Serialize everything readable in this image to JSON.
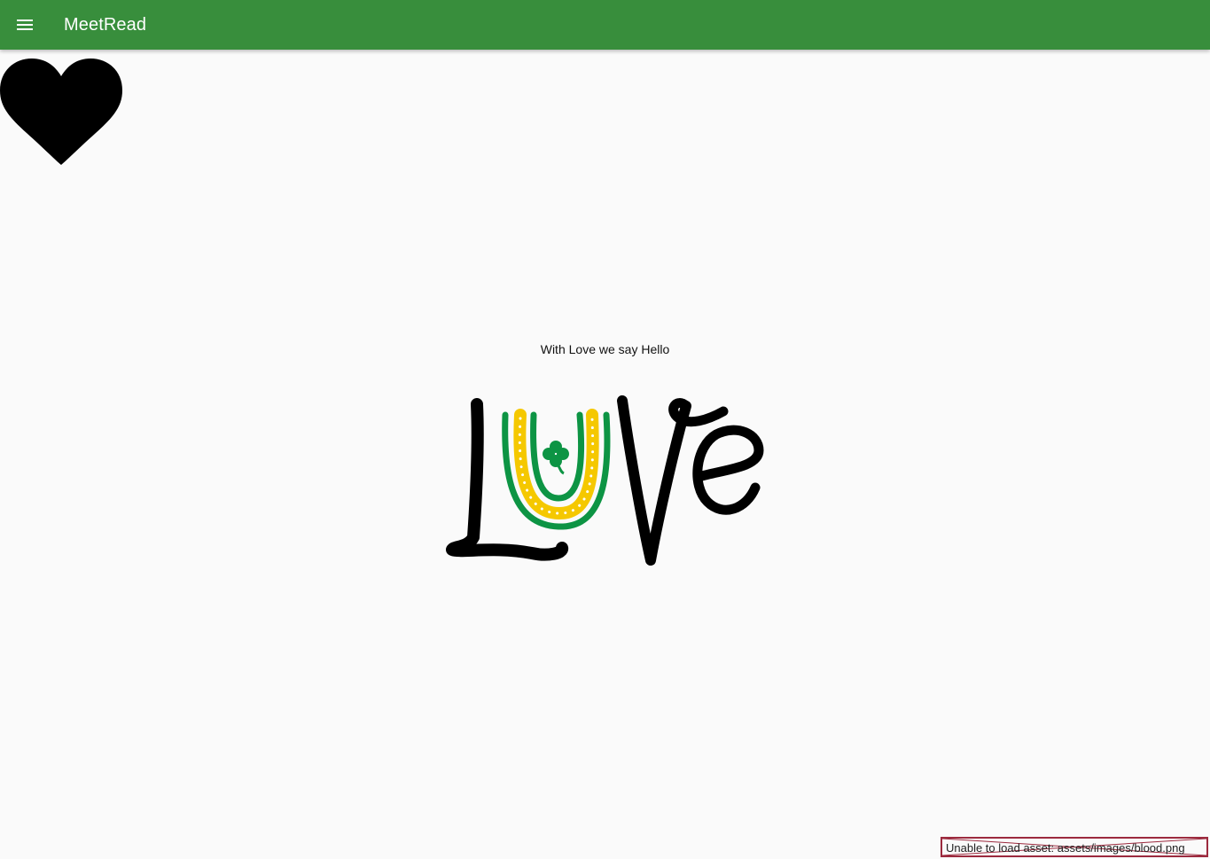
{
  "app_bar": {
    "title": "MeetRead",
    "menu_icon": "hamburger-menu-icon",
    "background_color": "#388e3c",
    "title_color": "#ffffff"
  },
  "heart": {
    "icon": "heart-icon",
    "color": "#000000"
  },
  "main": {
    "greeting": "With Love we say Hello",
    "love_artwork": {
      "icon": "love-lettering-image",
      "colors": {
        "letters": "#000000",
        "outer_arc": "#0d9444",
        "inner_arc": "#f5c800",
        "clover": "#0d9444"
      }
    }
  },
  "error": {
    "message": "Unable to load asset: assets/images/blood.png",
    "border_color": "#9c2a3e"
  }
}
